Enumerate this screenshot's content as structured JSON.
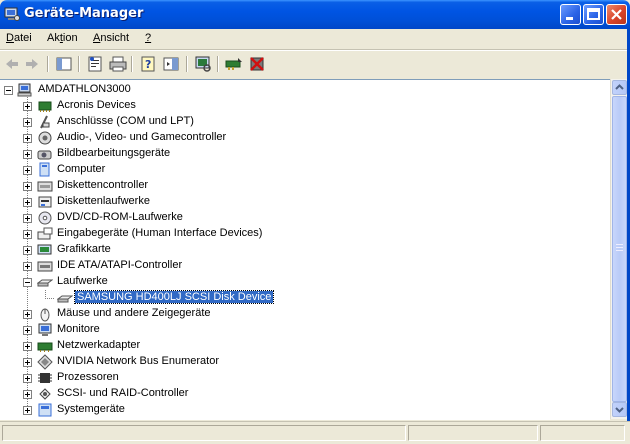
{
  "window": {
    "title": "Geräte-Manager"
  },
  "menu": [
    {
      "pre": "",
      "u": "D",
      "post": "atei"
    },
    {
      "pre": "Ak",
      "u": "t",
      "post": "ion"
    },
    {
      "pre": "",
      "u": "A",
      "post": "nsicht"
    },
    {
      "pre": "",
      "u": "?",
      "post": ""
    }
  ],
  "tree": {
    "root": "AMDATHLON3000",
    "items": [
      {
        "label": "Acronis Devices",
        "icon": "chip-icon",
        "expanded": false
      },
      {
        "label": "Anschlüsse (COM und LPT)",
        "icon": "port-icon",
        "expanded": false
      },
      {
        "label": "Audio-, Video- und Gamecontroller",
        "icon": "speaker-icon",
        "expanded": false
      },
      {
        "label": "Bildbearbeitungsgeräte",
        "icon": "camera-icon",
        "expanded": false
      },
      {
        "label": "Computer",
        "icon": "computer-icon",
        "expanded": false
      },
      {
        "label": "Diskettencontroller",
        "icon": "floppy-controller-icon",
        "expanded": false
      },
      {
        "label": "Diskettenlaufwerke",
        "icon": "floppy-drive-icon",
        "expanded": false
      },
      {
        "label": "DVD/CD-ROM-Laufwerke",
        "icon": "cdrom-icon",
        "expanded": false
      },
      {
        "label": "Eingabegeräte (Human Interface Devices)",
        "icon": "hid-icon",
        "expanded": false
      },
      {
        "label": "Grafikkarte",
        "icon": "display-adapter-icon",
        "expanded": false
      },
      {
        "label": "IDE ATA/ATAPI-Controller",
        "icon": "ide-controller-icon",
        "expanded": false
      },
      {
        "label": "Laufwerke",
        "icon": "disk-drive-icon",
        "expanded": true,
        "children": [
          {
            "label": "SAMSUNG HD400LJ SCSI Disk Device",
            "icon": "disk-drive-icon",
            "selected": true
          }
        ]
      },
      {
        "label": "Mäuse und andere Zeigegeräte",
        "icon": "mouse-icon",
        "expanded": false
      },
      {
        "label": "Monitore",
        "icon": "monitor-icon",
        "expanded": false
      },
      {
        "label": "Netzwerkadapter",
        "icon": "network-adapter-icon",
        "expanded": false
      },
      {
        "label": "NVIDIA Network Bus Enumerator",
        "icon": "diamond-icon",
        "expanded": false
      },
      {
        "label": "Prozessoren",
        "icon": "processor-icon",
        "expanded": false
      },
      {
        "label": "SCSI- und RAID-Controller",
        "icon": "scsi-icon",
        "expanded": false
      },
      {
        "label": "Systemgeräte",
        "icon": "system-device-icon",
        "expanded": false
      }
    ]
  },
  "colors": {
    "titlebar": "#0054e3",
    "selection": "#316ac5",
    "chrome": "#ece9d8"
  }
}
